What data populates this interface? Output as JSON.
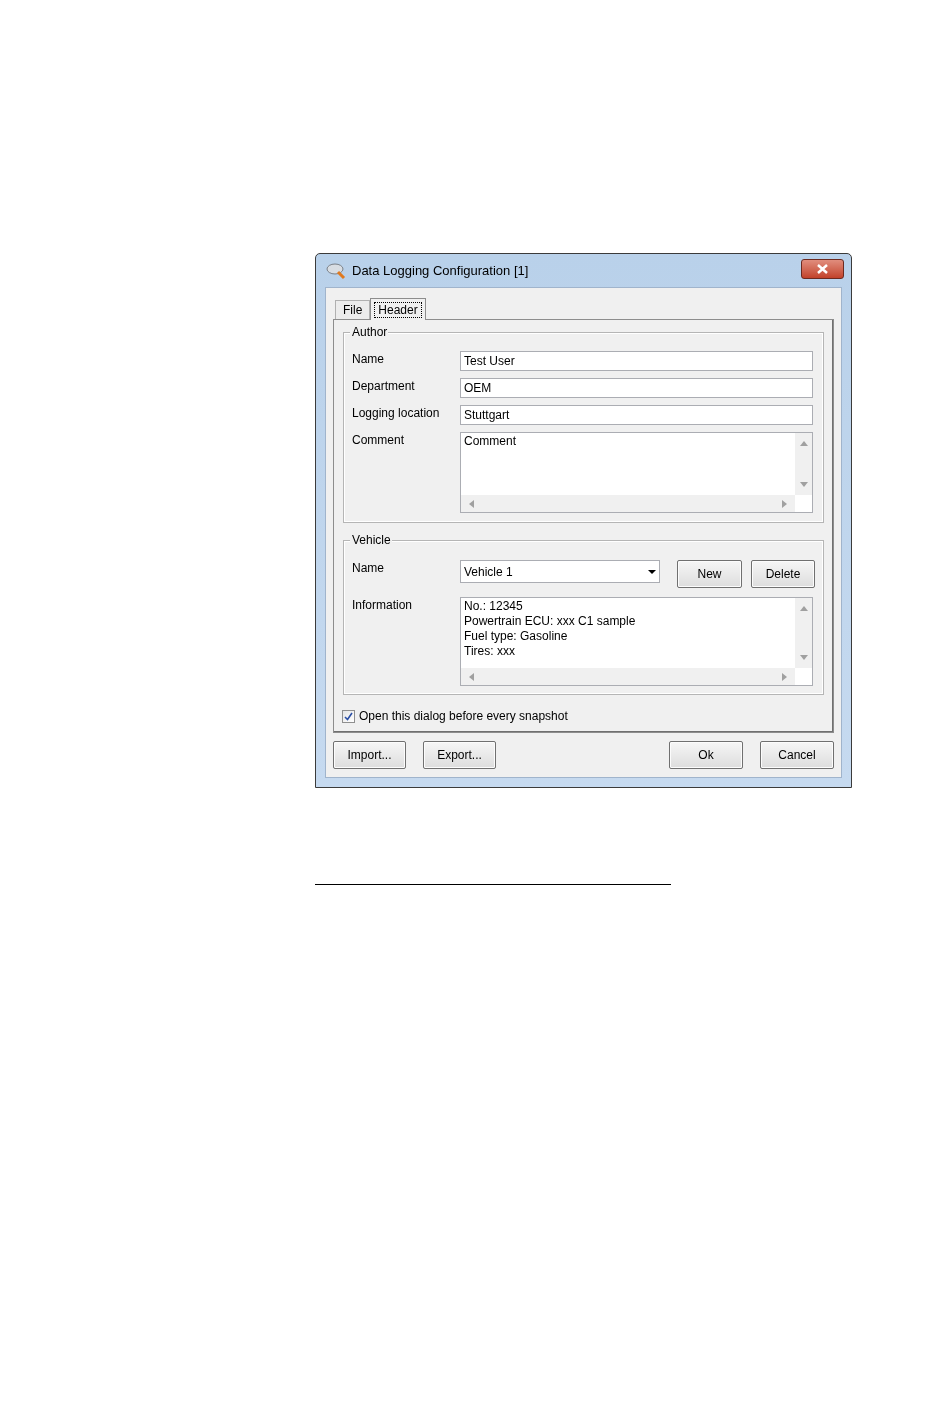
{
  "window": {
    "title": "Data Logging Configuration [1]"
  },
  "tabs": [
    {
      "label": "File",
      "selected": false
    },
    {
      "label": "Header",
      "selected": true
    }
  ],
  "author": {
    "legend": "Author",
    "fields": [
      {
        "kind": "text",
        "label": "Name",
        "value": "Test User"
      },
      {
        "kind": "text",
        "label": "Department",
        "value": "OEM"
      },
      {
        "kind": "text",
        "label": "Logging location",
        "value": "Stuttgart"
      },
      {
        "kind": "textarea",
        "label": "Comment",
        "value": "Comment"
      }
    ]
  },
  "vehicle": {
    "legend": "Vehicle",
    "name_label": "Name",
    "name_value": "Vehicle 1",
    "buttons": [
      "New",
      "Delete"
    ],
    "info_label": "Information",
    "info_lines": [
      "No.: 12345",
      "Powertrain ECU: xxx C1 sample",
      "Fuel type: Gasoline",
      "Tires: xxx"
    ]
  },
  "open_before_snapshot": {
    "label": "Open this dialog before every snapshot",
    "checked": true
  },
  "left_buttons": [
    "Import...",
    "Export..."
  ],
  "right_buttons": [
    "Ok",
    "Cancel"
  ]
}
